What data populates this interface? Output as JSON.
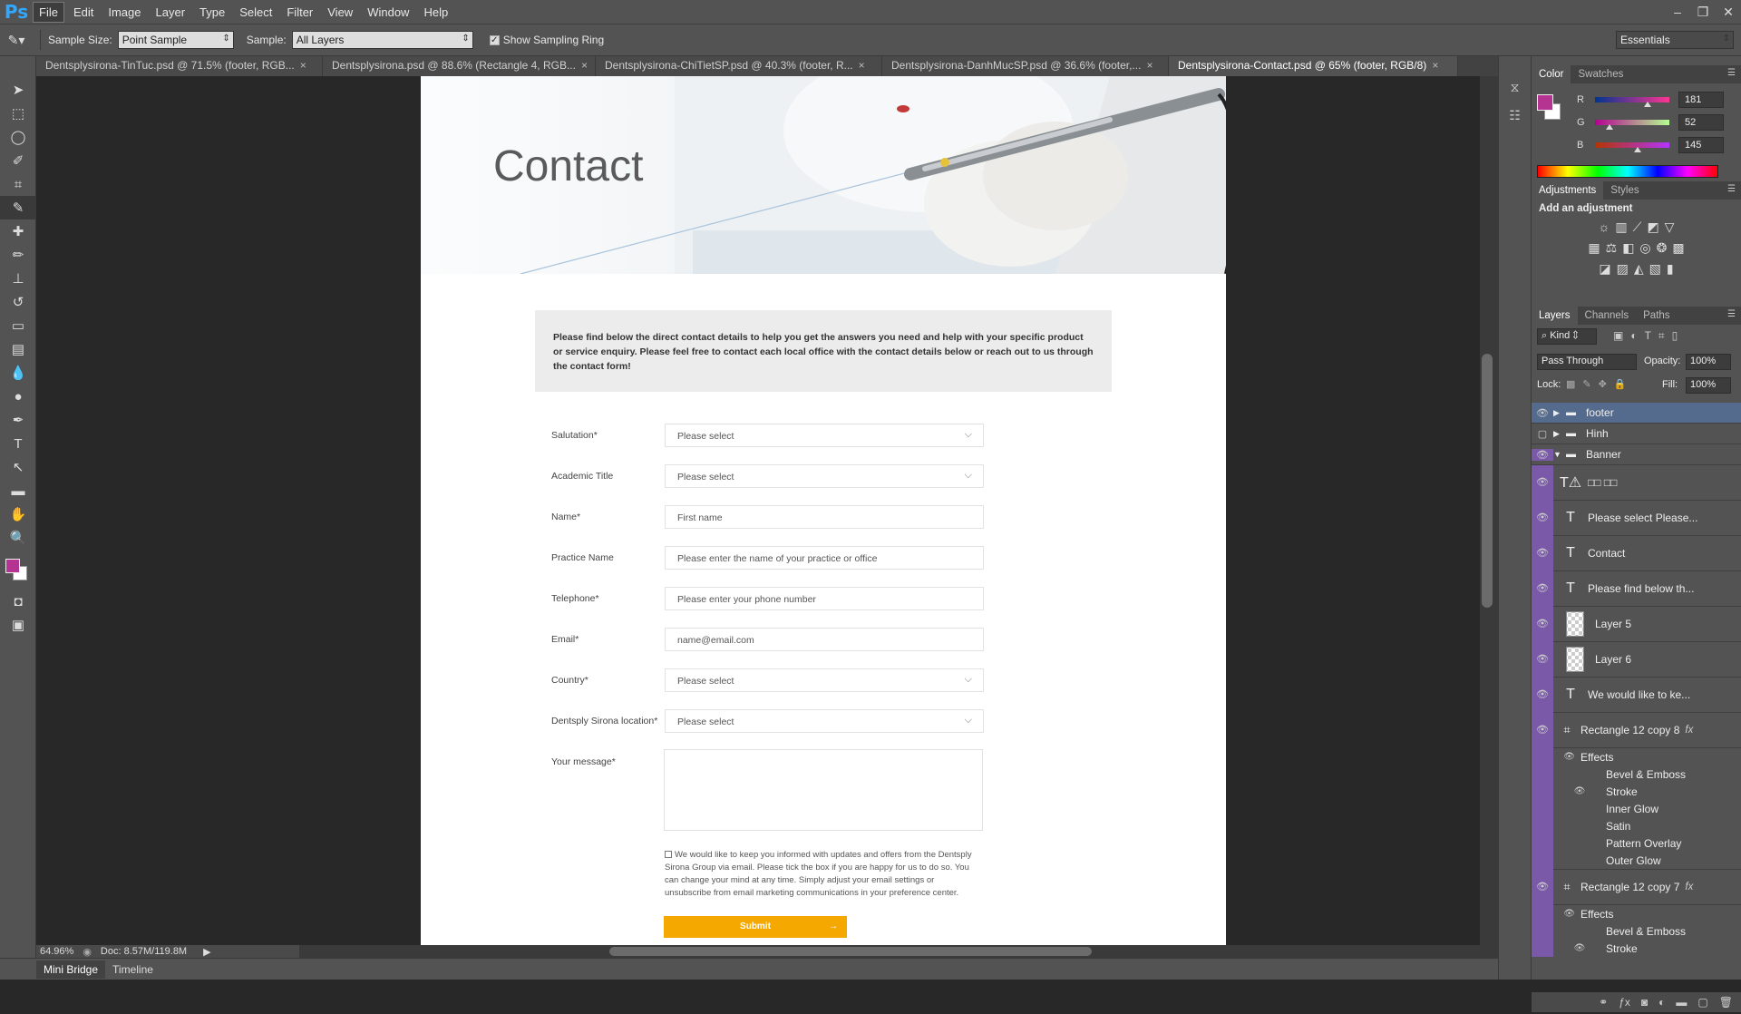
{
  "app": {
    "logo": "Ps"
  },
  "menubar": {
    "items": [
      "File",
      "Edit",
      "Image",
      "Layer",
      "Type",
      "Select",
      "Filter",
      "View",
      "Window",
      "Help"
    ]
  },
  "window_controls": [
    "minimize-icon",
    "restore-icon",
    "close-icon"
  ],
  "options_bar": {
    "sample_size_label": "Sample Size:",
    "sample_size_value": "Point Sample",
    "sample_label": "Sample:",
    "sample_value": "All Layers",
    "show_ring_label": "Show Sampling Ring",
    "workspace": "Essentials"
  },
  "tabs": [
    {
      "label": "Dentsplysirona-TinTuc.psd @ 71.5% (footer, RGB..."
    },
    {
      "label": "Dentsplysirona.psd @ 88.6% (Rectangle 4, RGB..."
    },
    {
      "label": "Dentsplysirona-ChiTietSP.psd @ 40.3% (footer, R..."
    },
    {
      "label": "Dentsplysirona-DanhMucSP.psd @ 36.6% (footer,..."
    },
    {
      "label": "Dentsplysirona-Contact.psd @ 65% (footer, RGB/8)"
    }
  ],
  "document": {
    "title": "Contact",
    "intro": "Please find below the direct contact details to help you get the answers you need and help with your specific product or service enquiry.  Please feel free to contact each local office with the contact details below or reach out to us through the contact form!",
    "fields": [
      {
        "label": "Salutation*",
        "value": "Please select",
        "dropdown": true
      },
      {
        "label": "Academic Title",
        "value": "Please select",
        "dropdown": true
      },
      {
        "label": "Name*",
        "value": "First name",
        "dropdown": false
      },
      {
        "label": "Practice Name",
        "value": "Please enter the name of your practice or office",
        "dropdown": false
      },
      {
        "label": "Telephone*",
        "value": "Please enter your phone number",
        "dropdown": false
      },
      {
        "label": "Email*",
        "value": "name@email.com",
        "dropdown": false
      },
      {
        "label": "Country*",
        "value": "Please select",
        "dropdown": true
      },
      {
        "label": "Dentsply Sirona location*",
        "value": "Please select",
        "dropdown": true
      }
    ],
    "message_label": "Your message*",
    "consent": "We would like to keep you informed with updates and offers from the Dentsply Sirona Group via email. Please tick the box if you are happy for us to do so. You can change your mind at any time. Simply adjust your email settings or unsubscribe from email marketing communications in your preference center.",
    "submit": "Submit"
  },
  "status": {
    "zoom": "64.96%",
    "doc": "Doc: 8.57M/119.8M"
  },
  "bottom_tabs": [
    "Mini Bridge",
    "Timeline"
  ],
  "color_panel": {
    "tabs": [
      "Color",
      "Swatches"
    ],
    "r_label": "R",
    "r": "181",
    "g_label": "G",
    "g": "52",
    "b_label": "B",
    "b": "145",
    "r_fraction": 0.71,
    "g_fraction": 0.2,
    "b_fraction": 0.57,
    "foreground": "#b53491"
  },
  "adjustments": {
    "tabs": [
      "Adjustments",
      "Styles"
    ],
    "heading": "Add an adjustment"
  },
  "layers_panel": {
    "tabs": [
      "Layers",
      "Channels",
      "Paths"
    ],
    "kind": "Kind",
    "blend": "Pass Through",
    "opacity_label": "Opacity:",
    "opacity": "100%",
    "lock_label": "Lock:",
    "fill_label": "Fill:",
    "fill": "100%",
    "layers": [
      {
        "name": "footer"
      },
      {
        "name": "Hinh"
      },
      {
        "name": "Banner"
      },
      {
        "name": "□□ □□"
      },
      {
        "name": "Please select Please..."
      },
      {
        "name": "Contact"
      },
      {
        "name": "Please find below th..."
      },
      {
        "name": "Layer 5"
      },
      {
        "name": "Layer 6"
      },
      {
        "name": "We would like to ke..."
      },
      {
        "name": "Rectangle 12 copy 8"
      },
      {
        "name": "Effects"
      },
      {
        "name": "Bevel & Emboss"
      },
      {
        "name": "Stroke"
      },
      {
        "name": "Inner Glow"
      },
      {
        "name": "Satin"
      },
      {
        "name": "Pattern Overlay"
      },
      {
        "name": "Outer Glow"
      },
      {
        "name": "Rectangle 12 copy 7"
      },
      {
        "name": "Effects"
      },
      {
        "name": "Bevel & Emboss"
      },
      {
        "name": "Stroke"
      }
    ],
    "fx": "fx"
  }
}
